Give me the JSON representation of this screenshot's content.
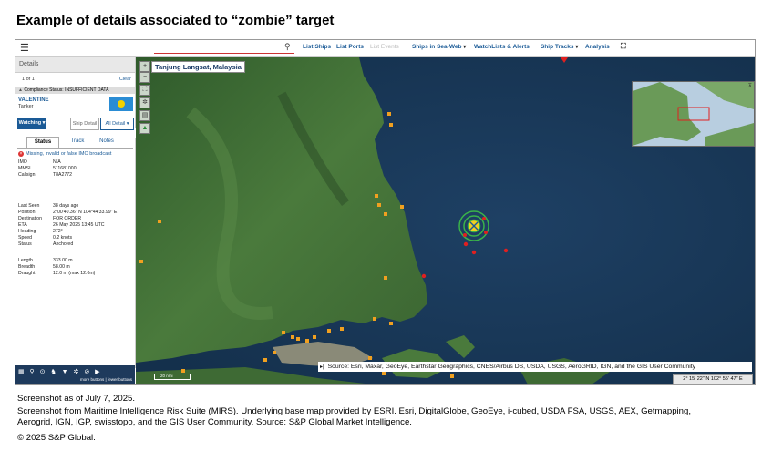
{
  "slide_title": "Example of details associated to “zombie” target",
  "toolbar": {
    "menu_icon": "hamburger-icon",
    "search_placeholder": "",
    "nav": [
      {
        "label": "List Ships"
      },
      {
        "label": "List Ports"
      },
      {
        "label": "List Events"
      },
      {
        "label": "Ships in Sea-Web"
      },
      {
        "label": "WatchLists & Alerts"
      },
      {
        "label": "Ship Tracks"
      },
      {
        "label": "Analysis"
      }
    ]
  },
  "details_panel": {
    "header": "Details",
    "count": "1 of 1",
    "clear": "Clear",
    "compliance": "Compliance Status: INSUFFICIENT DATA",
    "vessel_name": "VALENTINE",
    "vessel_type": "Tanker",
    "flag_colors": {
      "field": "#2a8cd4",
      "disc": "#f2d200"
    },
    "buttons": {
      "watching": "Watching ▾",
      "ship_detail": "Ship Detail",
      "all_detail": "All Detail ▾"
    },
    "tabs": [
      "Status",
      "Track",
      "Notes"
    ],
    "warning": "Missing, invalid or false IMO broadcast",
    "fields_a": [
      {
        "k": "IMO",
        "v": "N/A"
      },
      {
        "k": "MMSI",
        "v": "511681000"
      },
      {
        "k": "Callsign",
        "v": "T8A2772"
      }
    ],
    "fields_b": [
      {
        "k": "Last Seen",
        "v": "38 days ago"
      },
      {
        "k": "Position",
        "v": "2°00'40.36\" N    104°44'33.99\" E"
      },
      {
        "k": "Destination",
        "v": "FOR ORDER"
      },
      {
        "k": "ETA",
        "v": "26 May 2025 13:45 UTC"
      },
      {
        "k": "Heading",
        "v": "272°"
      },
      {
        "k": "Speed",
        "v": "0.2 knots"
      },
      {
        "k": "Status",
        "v": "Anchored"
      }
    ],
    "fields_c": [
      {
        "k": "Length",
        "v": "333.00 m"
      },
      {
        "k": "Breadth",
        "v": "58.00 m"
      },
      {
        "k": "Draught",
        "v": "12.0 m (max 12.0m)"
      }
    ],
    "bottom_bar": {
      "more_fewer": "more buttons | fewer buttons"
    }
  },
  "map": {
    "location_label": "Tanjung Langsat, Malaysia",
    "scale_label": "20 nmi",
    "source": "Source: Esri, Maxar, GeoEye, Earthstar Geographics, CNES/Airbus DS, USDA, USGS, AeroGRID, IGN, and the GIS User Community",
    "coords": "2° 15' 22\" N 102° 55' 47\" E",
    "colors": {
      "sea": "#1c3a5a",
      "land": "#3d6a35",
      "port_marker": "#f0a020",
      "ship_marker": "#e02020",
      "target_ring": "#3ab34a"
    }
  },
  "captions": {
    "date": "Screenshot as of July 7, 2025.",
    "source": "Screenshot from Maritime Intelligence Risk Suite (MIRS). Underlying base map provided by ESRI. Esri, DigitalGlobe, GeoEye, i-cubed, USDA FSA, USGS, AEX, Getmapping, Aerogrid, IGN, IGP, swisstopo, and the GIS User Community. Source: S&P Global Market Intelligence.",
    "copyright": "© 2025 S&P Global."
  }
}
